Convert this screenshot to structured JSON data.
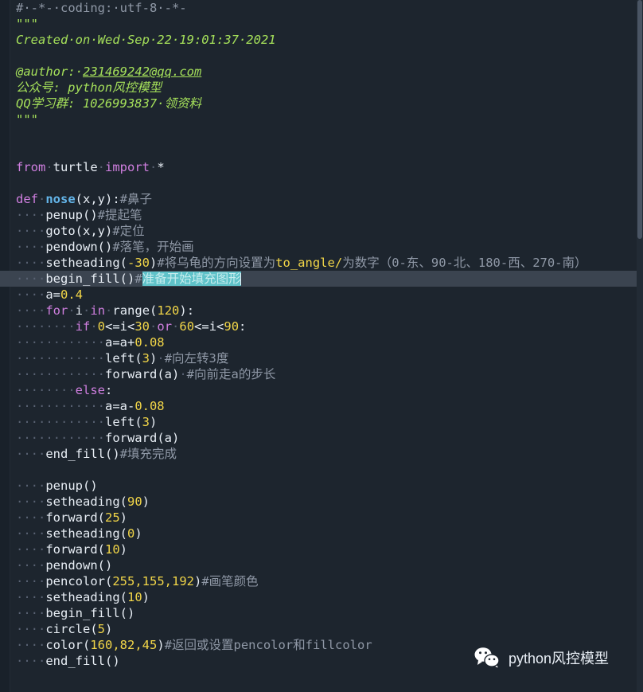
{
  "editor": {
    "background_color": "#1d252e",
    "current_line_color": "#3b4450",
    "selection_color": "#5fc2c9",
    "gutter_color": "#19212a"
  },
  "watermark": {
    "label": "python风控模型",
    "icon": "wechat-icon"
  },
  "code": {
    "lines": [
      {
        "n": 1,
        "fold": false,
        "cur": false,
        "tokens": [
          {
            "t": "cmt",
            "v": "#·-*-·coding:·utf-8·-*-"
          }
        ]
      },
      {
        "n": 2,
        "fold": true,
        "cur": false,
        "tokens": [
          {
            "t": "str",
            "v": "\"\"\""
          }
        ]
      },
      {
        "n": 3,
        "fold": false,
        "cur": false,
        "tokens": [
          {
            "t": "str",
            "v": "Created·on·Wed·Sep·22·19:01:37·2021"
          }
        ]
      },
      {
        "n": 4,
        "fold": false,
        "cur": false,
        "tokens": []
      },
      {
        "n": 5,
        "fold": false,
        "cur": false,
        "tokens": [
          {
            "t": "str",
            "v": "@author:·"
          },
          {
            "t": "str ul",
            "v": "231469242@qq.com"
          }
        ]
      },
      {
        "n": 6,
        "fold": false,
        "cur": false,
        "tokens": [
          {
            "t": "str",
            "v": "公众号: python风控模型"
          }
        ]
      },
      {
        "n": 7,
        "fold": false,
        "cur": false,
        "tokens": [
          {
            "t": "str",
            "v": "QQ学习群: 1026993837·领资料"
          }
        ]
      },
      {
        "n": 8,
        "fold": false,
        "cur": false,
        "tokens": [
          {
            "t": "str",
            "v": "\"\"\""
          }
        ]
      },
      {
        "n": 9,
        "fold": false,
        "cur": false,
        "tokens": []
      },
      {
        "n": 10,
        "fold": false,
        "cur": false,
        "tokens": []
      },
      {
        "n": 11,
        "fold": false,
        "cur": false,
        "tokens": [
          {
            "t": "kw",
            "v": "from"
          },
          {
            "t": "dots",
            "v": "·"
          },
          {
            "t": "id",
            "v": "turtle"
          },
          {
            "t": "dots",
            "v": "·"
          },
          {
            "t": "kw",
            "v": "import"
          },
          {
            "t": "dots",
            "v": "·"
          },
          {
            "t": "op",
            "v": "*"
          }
        ]
      },
      {
        "n": 12,
        "fold": false,
        "cur": false,
        "tokens": []
      },
      {
        "n": 13,
        "fold": true,
        "cur": false,
        "tokens": [
          {
            "t": "kw",
            "v": "def"
          },
          {
            "t": "dots",
            "v": "·"
          },
          {
            "t": "fn",
            "v": "nose"
          },
          {
            "t": "op",
            "v": "(x,y):"
          },
          {
            "t": "cmt",
            "v": "#鼻子"
          }
        ]
      },
      {
        "n": 14,
        "fold": false,
        "cur": false,
        "tokens": [
          {
            "t": "dots",
            "v": "····"
          },
          {
            "t": "id",
            "v": "penup"
          },
          {
            "t": "op",
            "v": "()"
          },
          {
            "t": "cmt",
            "v": "#提起笔"
          }
        ]
      },
      {
        "n": 15,
        "fold": false,
        "cur": false,
        "tokens": [
          {
            "t": "dots",
            "v": "····"
          },
          {
            "t": "id",
            "v": "goto"
          },
          {
            "t": "op",
            "v": "(x,y)"
          },
          {
            "t": "cmt",
            "v": "#定位"
          }
        ]
      },
      {
        "n": 16,
        "fold": false,
        "cur": false,
        "tokens": [
          {
            "t": "dots",
            "v": "····"
          },
          {
            "t": "id",
            "v": "pendown"
          },
          {
            "t": "op",
            "v": "()"
          },
          {
            "t": "cmt",
            "v": "#落笔，开始画"
          }
        ]
      },
      {
        "n": 17,
        "fold": false,
        "cur": false,
        "tokens": [
          {
            "t": "dots",
            "v": "····"
          },
          {
            "t": "id",
            "v": "setheading"
          },
          {
            "t": "op",
            "v": "("
          },
          {
            "t": "num",
            "v": "-30"
          },
          {
            "t": "op",
            "v": ")"
          },
          {
            "t": "cmt",
            "v": "#将乌龟的方向设置为"
          },
          {
            "t": "num",
            "v": "to_angle/"
          },
          {
            "t": "cmt",
            "v": "为数字（"
          },
          {
            "t": "cmt",
            "v": "0-东、90-北、180-西、270-南）"
          }
        ]
      },
      {
        "n": 18,
        "fold": false,
        "cur": true,
        "tokens": [
          {
            "t": "dots",
            "v": "····"
          },
          {
            "t": "id",
            "v": "begin_fill"
          },
          {
            "t": "op",
            "v": "()"
          },
          {
            "t": "cmt",
            "v": "#"
          },
          {
            "t": "sel",
            "v": "准备开始填充图形"
          },
          {
            "t": "caret",
            "v": ""
          }
        ]
      },
      {
        "n": 19,
        "fold": false,
        "cur": false,
        "tokens": [
          {
            "t": "dots",
            "v": "····"
          },
          {
            "t": "id",
            "v": "a="
          },
          {
            "t": "num",
            "v": "0.4"
          }
        ]
      },
      {
        "n": 20,
        "fold": true,
        "cur": false,
        "tokens": [
          {
            "t": "dots",
            "v": "····"
          },
          {
            "t": "kw",
            "v": "for"
          },
          {
            "t": "dots",
            "v": "·"
          },
          {
            "t": "id",
            "v": "i"
          },
          {
            "t": "dots",
            "v": "·"
          },
          {
            "t": "kw",
            "v": "in"
          },
          {
            "t": "dots",
            "v": "·"
          },
          {
            "t": "id",
            "v": "range"
          },
          {
            "t": "op",
            "v": "("
          },
          {
            "t": "num",
            "v": "120"
          },
          {
            "t": "op",
            "v": "):"
          }
        ]
      },
      {
        "n": 21,
        "fold": true,
        "cur": false,
        "tokens": [
          {
            "t": "dots",
            "v": "········"
          },
          {
            "t": "kw",
            "v": "if"
          },
          {
            "t": "dots",
            "v": "·"
          },
          {
            "t": "num",
            "v": "0"
          },
          {
            "t": "op",
            "v": "<=i<"
          },
          {
            "t": "num",
            "v": "30"
          },
          {
            "t": "dots",
            "v": "·"
          },
          {
            "t": "kw",
            "v": "or"
          },
          {
            "t": "dots",
            "v": "·"
          },
          {
            "t": "num",
            "v": "60"
          },
          {
            "t": "op",
            "v": "<=i<"
          },
          {
            "t": "num",
            "v": "90"
          },
          {
            "t": "op",
            "v": ":"
          }
        ]
      },
      {
        "n": 22,
        "fold": false,
        "cur": false,
        "tokens": [
          {
            "t": "dots",
            "v": "············"
          },
          {
            "t": "id",
            "v": "a=a+"
          },
          {
            "t": "num",
            "v": "0.08"
          }
        ]
      },
      {
        "n": 23,
        "fold": false,
        "cur": false,
        "tokens": [
          {
            "t": "dots",
            "v": "············"
          },
          {
            "t": "id",
            "v": "left"
          },
          {
            "t": "op",
            "v": "("
          },
          {
            "t": "num",
            "v": "3"
          },
          {
            "t": "op",
            "v": ")"
          },
          {
            "t": "dots",
            "v": "·"
          },
          {
            "t": "cmt",
            "v": "#向左转3度"
          }
        ]
      },
      {
        "n": 24,
        "fold": false,
        "cur": false,
        "tokens": [
          {
            "t": "dots",
            "v": "············"
          },
          {
            "t": "id",
            "v": "forward"
          },
          {
            "t": "op",
            "v": "(a)"
          },
          {
            "t": "dots",
            "v": "·"
          },
          {
            "t": "cmt",
            "v": "#向前走a的步长"
          }
        ]
      },
      {
        "n": 25,
        "fold": true,
        "cur": false,
        "tokens": [
          {
            "t": "dots",
            "v": "········"
          },
          {
            "t": "kw",
            "v": "else"
          },
          {
            "t": "op",
            "v": ":"
          }
        ]
      },
      {
        "n": 26,
        "fold": false,
        "cur": false,
        "tokens": [
          {
            "t": "dots",
            "v": "············"
          },
          {
            "t": "id",
            "v": "a=a-"
          },
          {
            "t": "num",
            "v": "0.08"
          }
        ]
      },
      {
        "n": 27,
        "fold": false,
        "cur": false,
        "tokens": [
          {
            "t": "dots",
            "v": "············"
          },
          {
            "t": "id",
            "v": "left"
          },
          {
            "t": "op",
            "v": "("
          },
          {
            "t": "num",
            "v": "3"
          },
          {
            "t": "op",
            "v": ")"
          }
        ]
      },
      {
        "n": 28,
        "fold": false,
        "cur": false,
        "tokens": [
          {
            "t": "dots",
            "v": "············"
          },
          {
            "t": "id",
            "v": "forward"
          },
          {
            "t": "op",
            "v": "(a)"
          }
        ]
      },
      {
        "n": 29,
        "fold": false,
        "cur": false,
        "tokens": [
          {
            "t": "dots",
            "v": "····"
          },
          {
            "t": "id",
            "v": "end_fill"
          },
          {
            "t": "op",
            "v": "()"
          },
          {
            "t": "cmt",
            "v": "#填充完成"
          }
        ]
      },
      {
        "n": 30,
        "fold": false,
        "cur": false,
        "tokens": []
      },
      {
        "n": 31,
        "fold": false,
        "cur": false,
        "tokens": [
          {
            "t": "dots",
            "v": "····"
          },
          {
            "t": "id",
            "v": "penup"
          },
          {
            "t": "op",
            "v": "()"
          }
        ]
      },
      {
        "n": 32,
        "fold": false,
        "cur": false,
        "tokens": [
          {
            "t": "dots",
            "v": "····"
          },
          {
            "t": "id",
            "v": "setheading"
          },
          {
            "t": "op",
            "v": "("
          },
          {
            "t": "num",
            "v": "90"
          },
          {
            "t": "op",
            "v": ")"
          }
        ]
      },
      {
        "n": 33,
        "fold": false,
        "cur": false,
        "tokens": [
          {
            "t": "dots",
            "v": "····"
          },
          {
            "t": "id",
            "v": "forward"
          },
          {
            "t": "op",
            "v": "("
          },
          {
            "t": "num",
            "v": "25"
          },
          {
            "t": "op",
            "v": ")"
          }
        ]
      },
      {
        "n": 34,
        "fold": false,
        "cur": false,
        "tokens": [
          {
            "t": "dots",
            "v": "····"
          },
          {
            "t": "id",
            "v": "setheading"
          },
          {
            "t": "op",
            "v": "("
          },
          {
            "t": "num",
            "v": "0"
          },
          {
            "t": "op",
            "v": ")"
          }
        ]
      },
      {
        "n": 35,
        "fold": false,
        "cur": false,
        "tokens": [
          {
            "t": "dots",
            "v": "····"
          },
          {
            "t": "id",
            "v": "forward"
          },
          {
            "t": "op",
            "v": "("
          },
          {
            "t": "num",
            "v": "10"
          },
          {
            "t": "op",
            "v": ")"
          }
        ]
      },
      {
        "n": 36,
        "fold": false,
        "cur": false,
        "tokens": [
          {
            "t": "dots",
            "v": "····"
          },
          {
            "t": "id",
            "v": "pendown"
          },
          {
            "t": "op",
            "v": "()"
          }
        ]
      },
      {
        "n": 37,
        "fold": false,
        "cur": false,
        "tokens": [
          {
            "t": "dots",
            "v": "····"
          },
          {
            "t": "id",
            "v": "pencolor"
          },
          {
            "t": "op",
            "v": "("
          },
          {
            "t": "num",
            "v": "255,155,192"
          },
          {
            "t": "op",
            "v": ")"
          },
          {
            "t": "cmt",
            "v": "#画笔颜色"
          }
        ]
      },
      {
        "n": 38,
        "fold": false,
        "cur": false,
        "tokens": [
          {
            "t": "dots",
            "v": "····"
          },
          {
            "t": "id",
            "v": "setheading"
          },
          {
            "t": "op",
            "v": "("
          },
          {
            "t": "num",
            "v": "10"
          },
          {
            "t": "op",
            "v": ")"
          }
        ]
      },
      {
        "n": 39,
        "fold": false,
        "cur": false,
        "tokens": [
          {
            "t": "dots",
            "v": "····"
          },
          {
            "t": "id",
            "v": "begin_fill"
          },
          {
            "t": "op",
            "v": "()"
          }
        ]
      },
      {
        "n": 40,
        "fold": false,
        "cur": false,
        "tokens": [
          {
            "t": "dots",
            "v": "····"
          },
          {
            "t": "id",
            "v": "circle"
          },
          {
            "t": "op",
            "v": "("
          },
          {
            "t": "num",
            "v": "5"
          },
          {
            "t": "op",
            "v": ")"
          }
        ]
      },
      {
        "n": 41,
        "fold": false,
        "cur": false,
        "tokens": [
          {
            "t": "dots",
            "v": "····"
          },
          {
            "t": "id",
            "v": "color"
          },
          {
            "t": "op",
            "v": "("
          },
          {
            "t": "num",
            "v": "160,82,45"
          },
          {
            "t": "op",
            "v": ")"
          },
          {
            "t": "cmt",
            "v": "#返回或设置pencolor和fillcolor"
          }
        ]
      },
      {
        "n": 42,
        "fold": false,
        "cur": false,
        "tokens": [
          {
            "t": "dots",
            "v": "····"
          },
          {
            "t": "id",
            "v": "end_fill"
          },
          {
            "t": "op",
            "v": "()"
          }
        ]
      }
    ]
  }
}
